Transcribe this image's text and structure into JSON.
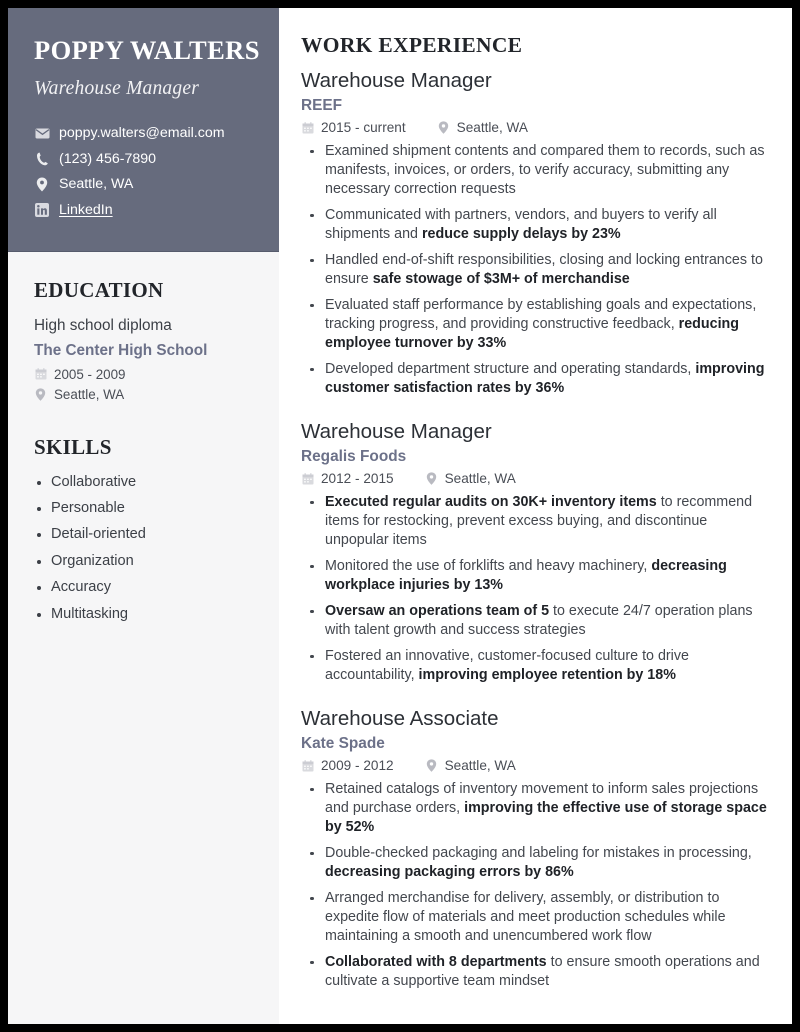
{
  "sidebar": {
    "name": "POPPY WALTERS",
    "title": "Warehouse Manager",
    "contacts": [
      {
        "icon": "envelope-icon",
        "text": "poppy.walters@email.com",
        "link": false
      },
      {
        "icon": "phone-icon",
        "text": "(123) 456-7890",
        "link": false
      },
      {
        "icon": "map-pin-icon",
        "text": "Seattle, WA",
        "link": false
      },
      {
        "icon": "linkedin-icon",
        "text": "LinkedIn",
        "link": true
      }
    ],
    "education": {
      "heading": "EDUCATION",
      "degree": "High school diploma",
      "school": "The Center High School",
      "dates": "2005 - 2009",
      "location": "Seattle, WA"
    },
    "skills": {
      "heading": "SKILLS",
      "items": [
        "Collaborative",
        "Personable",
        "Detail-oriented",
        "Organization",
        "Accuracy",
        "Multitasking"
      ]
    }
  },
  "main": {
    "heading": "WORK EXPERIENCE",
    "jobs": [
      {
        "role": "Warehouse Manager",
        "company": "REEF",
        "dates": "2015 - current",
        "location": "Seattle, WA",
        "bullets": [
          [
            {
              "t": "Examined shipment contents and compared them to records, such as manifests, invoices, or orders, to verify accuracy, submitting any necessary correction requests",
              "b": false
            }
          ],
          [
            {
              "t": "Communicated with partners, vendors, and buyers to verify all shipments and ",
              "b": false
            },
            {
              "t": "reduce supply delays by 23%",
              "b": true
            }
          ],
          [
            {
              "t": "Handled end-of-shift responsibilities, closing and locking entrances to ensure ",
              "b": false
            },
            {
              "t": "safe stowage of $3M+ of merchandise",
              "b": true
            }
          ],
          [
            {
              "t": "Evaluated staff performance by establishing goals and expectations, tracking progress, and providing constructive feedback, ",
              "b": false
            },
            {
              "t": "reducing employee turnover by 33%",
              "b": true
            }
          ],
          [
            {
              "t": "Developed department structure and operating standards, ",
              "b": false
            },
            {
              "t": "improving customer satisfaction rates by 36%",
              "b": true
            }
          ]
        ]
      },
      {
        "role": "Warehouse Manager",
        "company": "Regalis Foods",
        "dates": "2012 - 2015",
        "location": "Seattle, WA",
        "bullets": [
          [
            {
              "t": "Executed regular audits on 30K+ inventory items",
              "b": true
            },
            {
              "t": " to recommend items for restocking, prevent excess buying, and discontinue unpopular items",
              "b": false
            }
          ],
          [
            {
              "t": "Monitored the use of forklifts and heavy machinery, ",
              "b": false
            },
            {
              "t": "decreasing workplace injuries by 13%",
              "b": true
            }
          ],
          [
            {
              "t": "Oversaw an operations team of 5",
              "b": true
            },
            {
              "t": " to execute 24/7 operation plans with talent growth and success strategies",
              "b": false
            }
          ],
          [
            {
              "t": "Fostered an innovative, customer-focused culture to drive accountability, ",
              "b": false
            },
            {
              "t": "improving employee retention by 18%",
              "b": true
            }
          ]
        ]
      },
      {
        "role": "Warehouse Associate",
        "company": "Kate Spade",
        "dates": "2009 - 2012",
        "location": "Seattle, WA",
        "bullets": [
          [
            {
              "t": "Retained catalogs of inventory movement to inform sales projections and purchase orders, ",
              "b": false
            },
            {
              "t": "improving the effective use of storage space by 52%",
              "b": true
            }
          ],
          [
            {
              "t": "Double-checked packaging and labeling for mistakes in processing, ",
              "b": false
            },
            {
              "t": "decreasing packaging errors by 86%",
              "b": true
            }
          ],
          [
            {
              "t": "Arranged merchandise for delivery, assembly, or distribution to expedite flow of materials and meet production schedules while maintaining a smooth and unencumbered work flow",
              "b": false
            }
          ],
          [
            {
              "t": "Collaborated with 8 departments",
              "b": true
            },
            {
              "t": " to ensure smooth operations and cultivate a supportive team mindset",
              "b": false
            }
          ]
        ]
      }
    ]
  }
}
